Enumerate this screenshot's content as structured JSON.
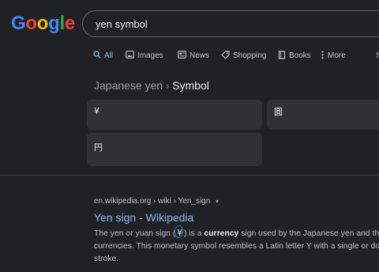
{
  "header": {
    "logo": {
      "letters": [
        {
          "char": "G",
          "color": "#4285f4"
        },
        {
          "char": "o",
          "color": "#ea4335"
        },
        {
          "char": "o",
          "color": "#fbbc05"
        },
        {
          "char": "g",
          "color": "#4285f4"
        },
        {
          "char": "l",
          "color": "#34a853"
        },
        {
          "char": "e",
          "color": "#ea4335"
        }
      ]
    },
    "search": {
      "value": "yen symbol"
    }
  },
  "tabs": [
    {
      "label": "All",
      "icon": "search-icon",
      "active": true
    },
    {
      "label": "Images",
      "icon": "image-icon",
      "active": false
    },
    {
      "label": "News",
      "icon": "news-icon",
      "active": false
    },
    {
      "label": "Shopping",
      "icon": "tag-icon",
      "active": false
    },
    {
      "label": "Books",
      "icon": "book-icon",
      "active": false
    },
    {
      "label": "More",
      "icon": "more-dots-icon",
      "active": false
    },
    {
      "label": "S",
      "icon": "",
      "active": false
    }
  ],
  "knowledge_panel": {
    "breadcrumb_parent": "Japanese yen",
    "breadcrumb_separator": "›",
    "breadcrumb_current": "Symbol",
    "symbols": [
      "¥",
      "圓",
      "円"
    ]
  },
  "result": {
    "url": "en.wikipedia.org › wiki › Yen_sign",
    "title": "Yen sign - Wikipedia",
    "snippet": {
      "line1_a": "The yen or yuan sign (",
      "line1_symbol": "¥",
      "line1_b": ") is a ",
      "line1_bold": "currency",
      "line1_c": " sign used by the Japanese yen and the Chin",
      "line2": "currencies. This monetary symbol resembles a Latin letter Y with a single or doub",
      "line3": "stroke."
    }
  },
  "colors": {
    "background": "#202124",
    "link": "#8ab4f8",
    "card": "#303134",
    "highlight_circle": "#2f6dd6"
  }
}
